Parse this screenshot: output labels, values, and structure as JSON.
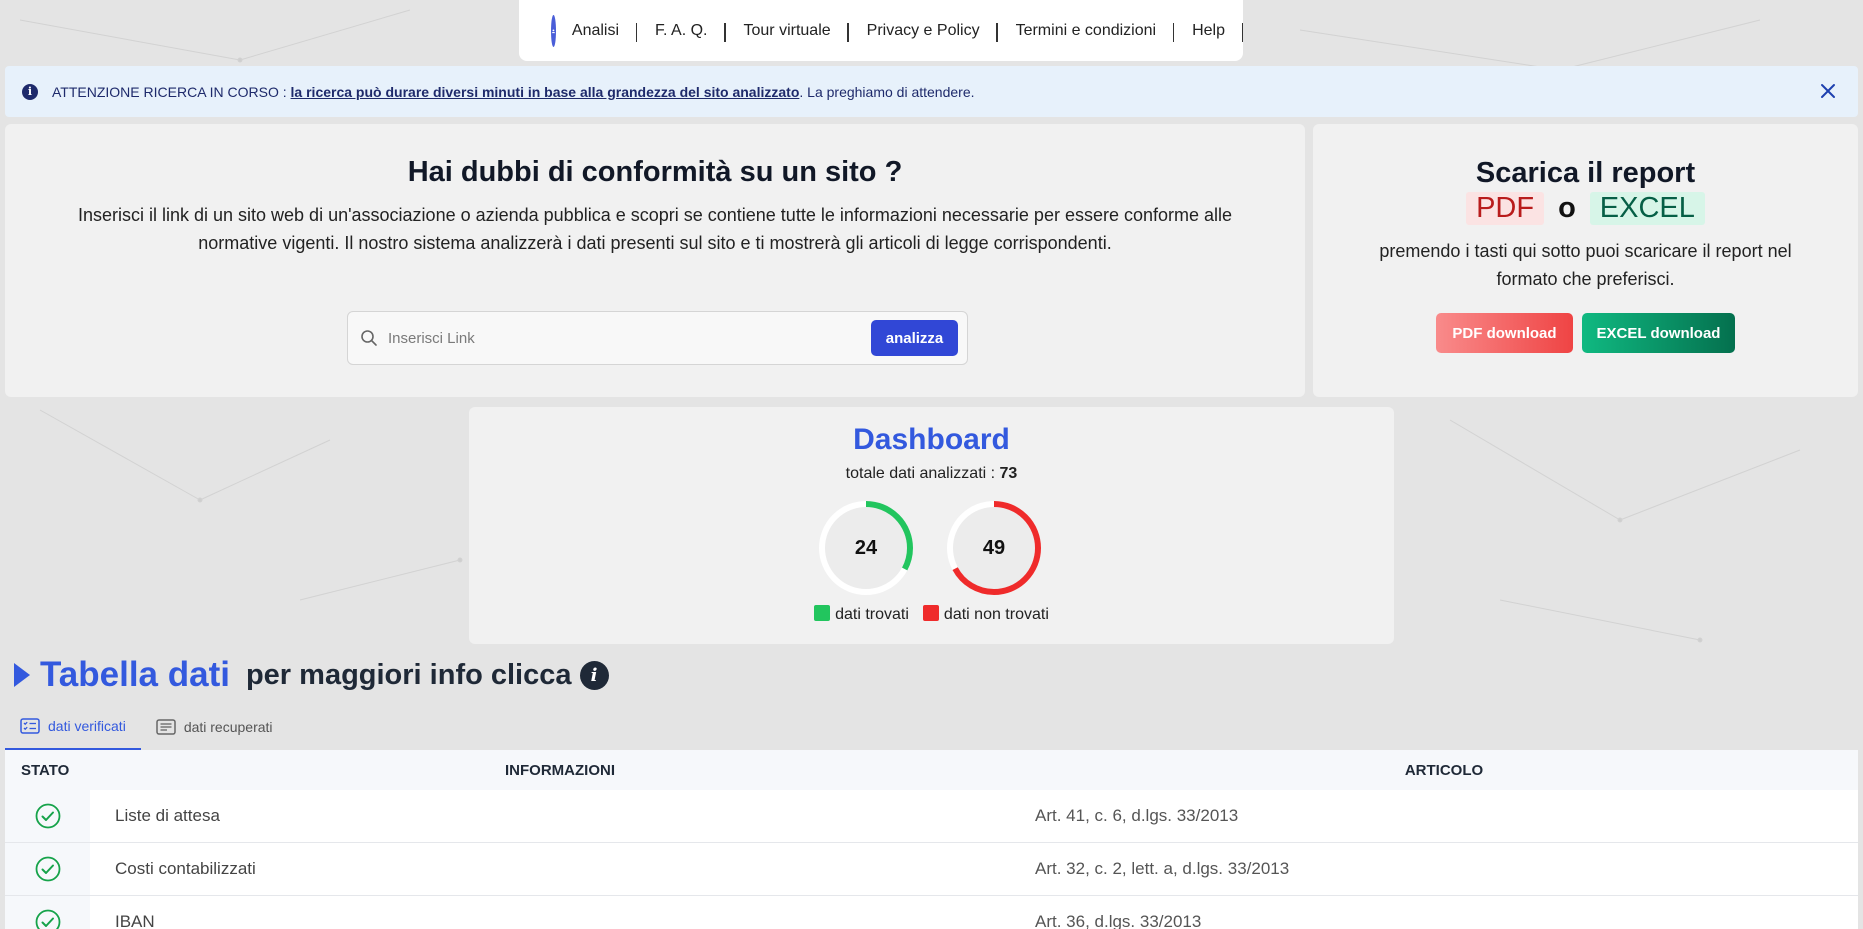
{
  "nav": {
    "items": [
      "Analisi",
      "F. A. Q.",
      "Tour virtuale",
      "Privacy e Policy",
      "Termini e condizioni",
      "Help"
    ]
  },
  "alert": {
    "prefix": "ATTENZIONE RICERCA IN CORSO :",
    "link": "la ricerca può durare diversi minuti in base alla grandezza del sito analizzato",
    "suffix": ". La preghiamo di attendere."
  },
  "search": {
    "title": "Hai dubbi di conformità su un sito ?",
    "description": "Inserisci il link di un sito web di un'associazione o azienda pubblica e scopri se contiene tutte le informazioni necessarie per essere conforme alle normative vigenti. Il nostro sistema analizzerà i dati presenti sul sito e ti mostrerà gli articoli di legge corrispondenti.",
    "placeholder": "Inserisci Link",
    "button": "analizza"
  },
  "report": {
    "title": "Scarica il report",
    "pdf": "PDF",
    "or": "o",
    "excel": "EXCEL",
    "description": "premendo i tasti qui sotto puoi scaricare il report nel formato che preferisci.",
    "pdf_button": "PDF download",
    "excel_button": "EXCEL download"
  },
  "dashboard": {
    "title": "Dashboard",
    "total_label": "totale dati analizzati :",
    "total": "73",
    "found": "24",
    "not_found": "49",
    "found_label": "dati trovati",
    "not_found_label": "dati non trovati",
    "colors": {
      "found": "#22c55e",
      "not_found": "#ef2b2b"
    }
  },
  "table_section": {
    "title": "Tabella dati",
    "subtitle": "per maggiori info clicca",
    "tabs": [
      "dati verificati",
      "dati recuperati"
    ],
    "headers": [
      "STATO",
      "INFORMAZIONI",
      "ARTICOLO"
    ],
    "rows": [
      {
        "info": "Liste di attesa",
        "article": "Art. 41, c. 6, d.lgs. 33/2013"
      },
      {
        "info": "Costi contabilizzati",
        "article": "Art. 32, c. 2, lett. a, d.lgs. 33/2013"
      },
      {
        "info": "IBAN",
        "article": "Art. 36, d.lgs. 33/2013"
      }
    ]
  }
}
